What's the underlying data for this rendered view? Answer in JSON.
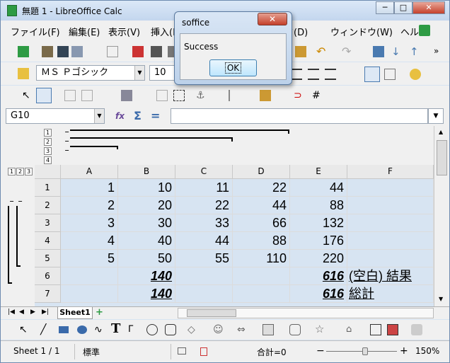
{
  "window": {
    "title": "無題 1 - LibreOffice Calc",
    "min": "─",
    "max": "□",
    "close": "✕"
  },
  "menu": [
    "ファイル(F)",
    "編集(E)",
    "表示(V)",
    "挿入(I",
    "ータ(D)",
    "ウィンドウ(W)",
    "ヘルプ"
  ],
  "format_bar": {
    "font_name": "ＭＳ Ｐゴシック",
    "font_size": "10"
  },
  "formula_bar": {
    "name_box": "G10",
    "fx": "fx",
    "sum": "Σ",
    "equals": "=",
    "content": ""
  },
  "outline": {
    "top_levels": [
      "1",
      "2",
      "3",
      "4"
    ],
    "left_levels": [
      "1",
      "2",
      "3"
    ]
  },
  "columns": [
    "A",
    "B",
    "C",
    "D",
    "E",
    "F"
  ],
  "rows": [
    {
      "num": "1",
      "cells": [
        "1",
        "10",
        "11",
        "22",
        "44",
        ""
      ]
    },
    {
      "num": "2",
      "cells": [
        "2",
        "20",
        "22",
        "44",
        "88",
        ""
      ]
    },
    {
      "num": "3",
      "cells": [
        "3",
        "30",
        "33",
        "66",
        "132",
        ""
      ]
    },
    {
      "num": "4",
      "cells": [
        "4",
        "40",
        "44",
        "88",
        "176",
        ""
      ]
    },
    {
      "num": "5",
      "cells": [
        "5",
        "50",
        "55",
        "110",
        "220",
        ""
      ]
    },
    {
      "num": "6",
      "cells": [
        "",
        "140",
        "",
        "",
        "616",
        "(空白) 結果"
      ]
    },
    {
      "num": "7",
      "cells": [
        "",
        "140",
        "",
        "",
        "616",
        "総計"
      ]
    }
  ],
  "sheet_tab": "Sheet1",
  "status": {
    "sheet": "Sheet 1 / 1",
    "style": "標準",
    "sum": "合計=0",
    "zoom": "150%",
    "zoom_level_percent": 150
  },
  "dialog": {
    "title": "soffice",
    "close": "✕",
    "message": "Success",
    "ok": "OK"
  }
}
